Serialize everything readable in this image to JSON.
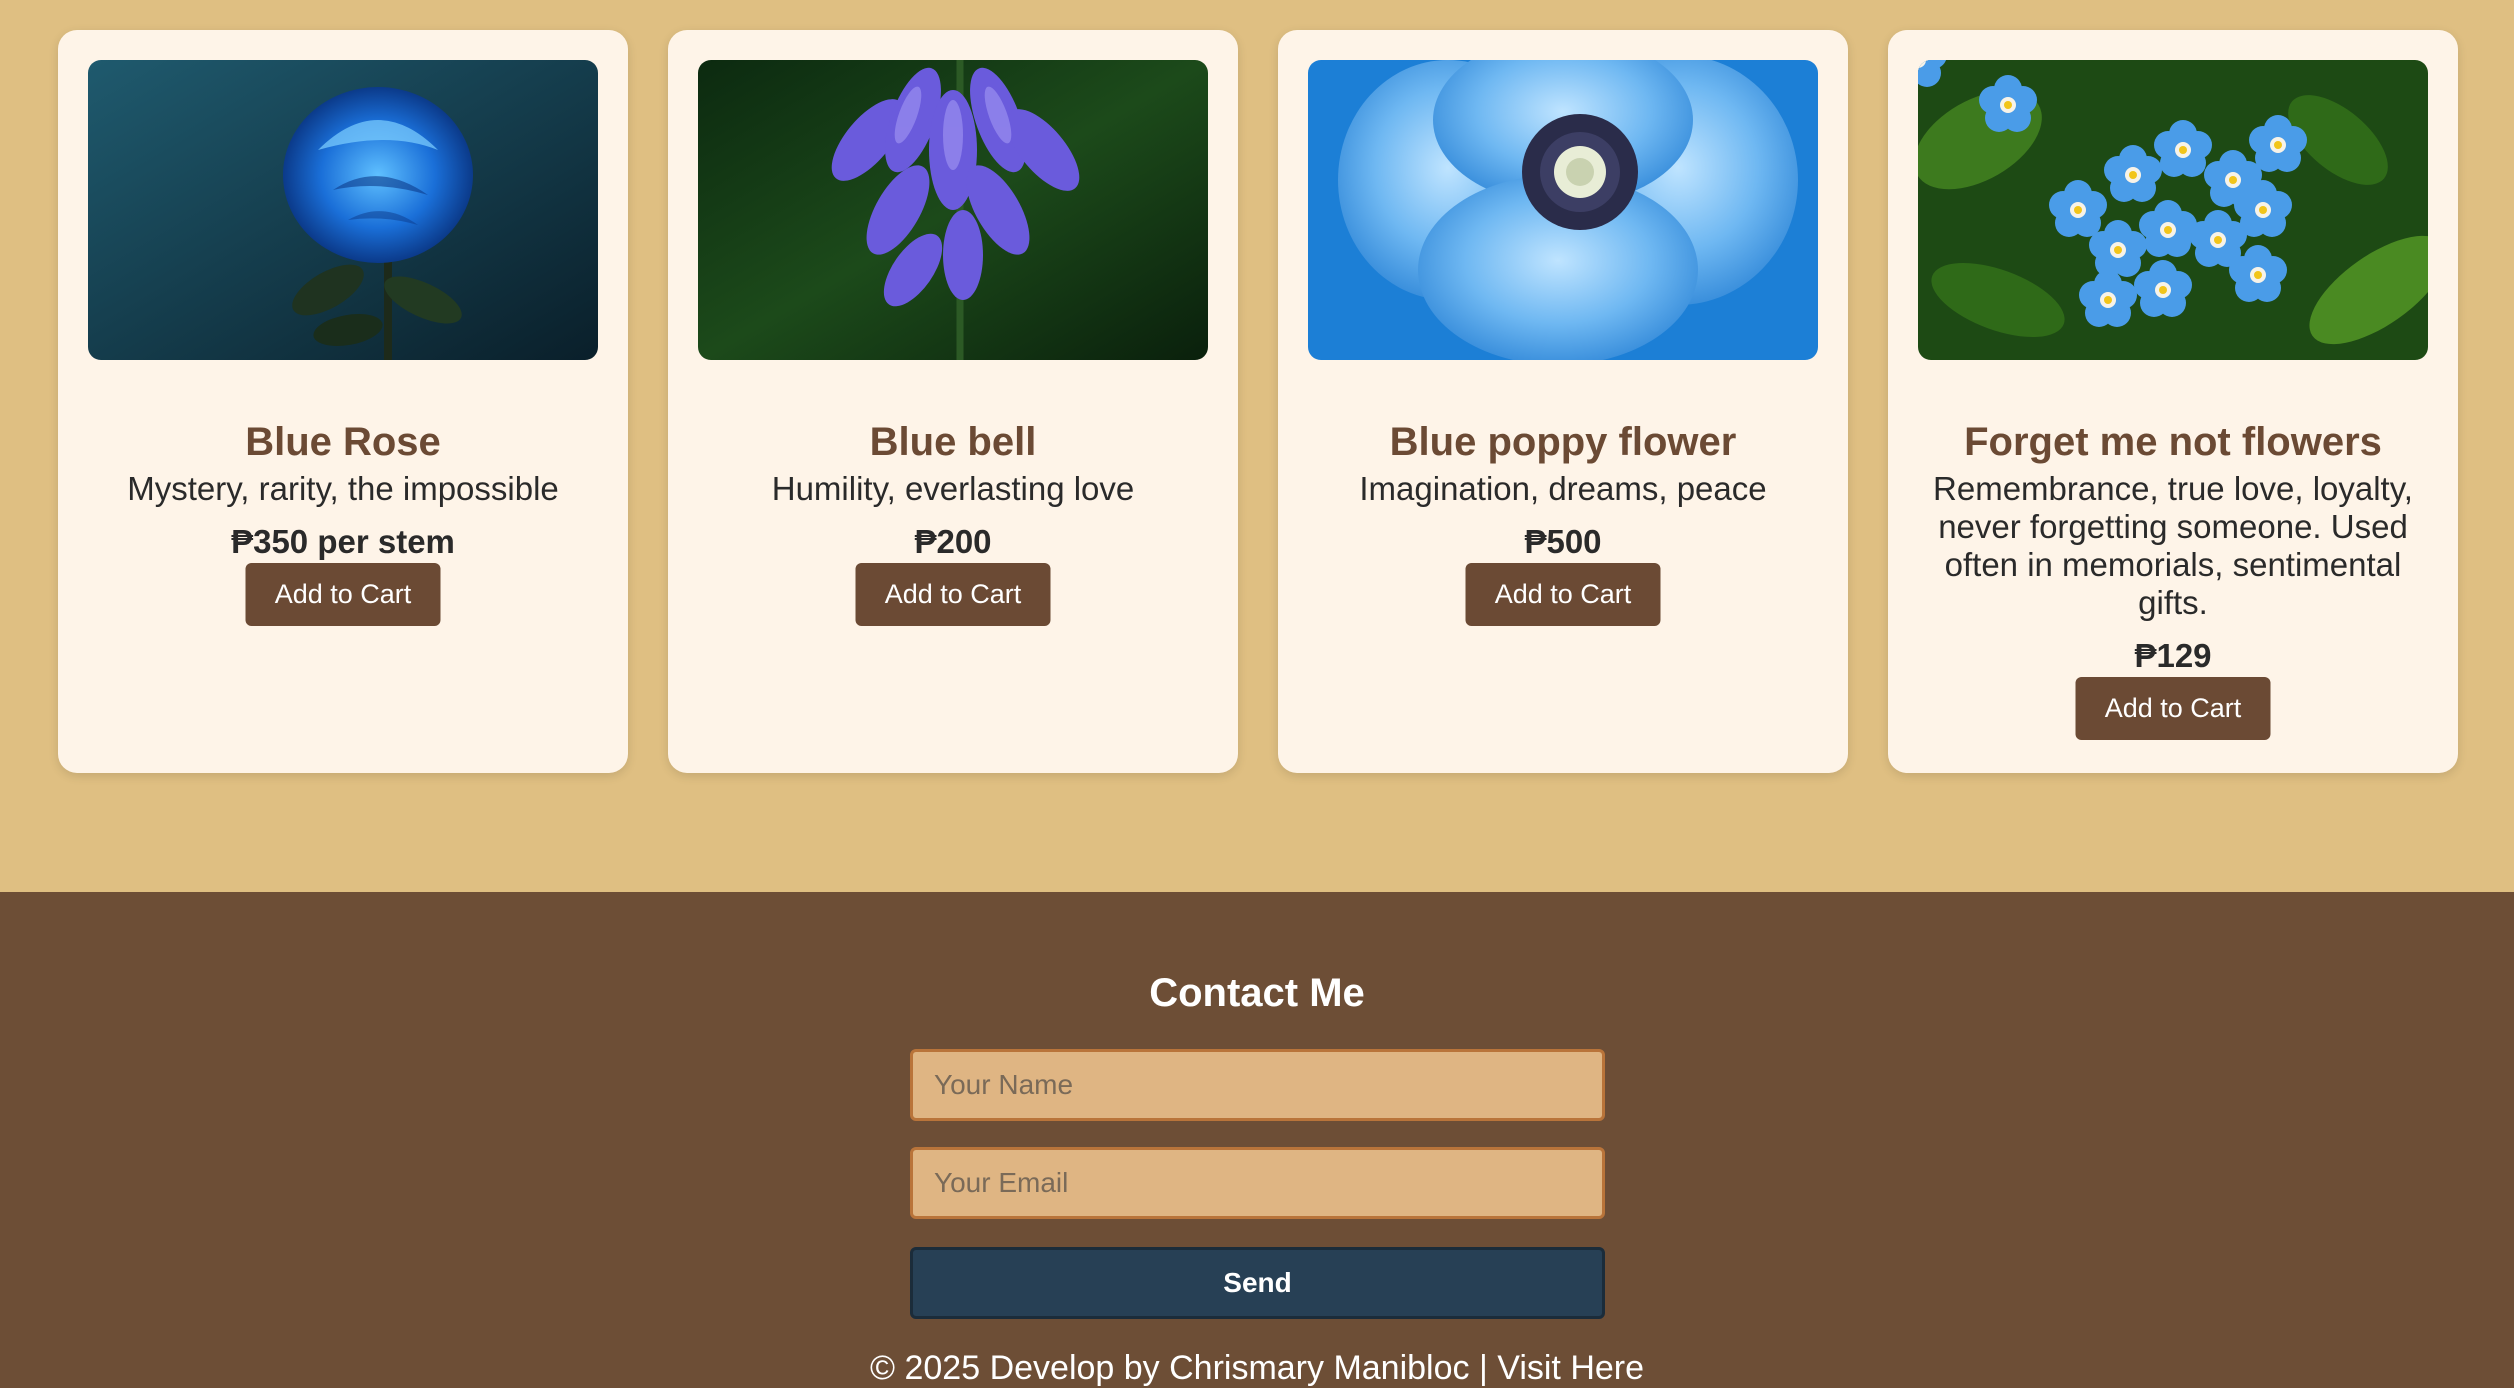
{
  "products": [
    {
      "title": "Blue Rose",
      "description": "Mystery, rarity, the impossible",
      "price": "₱350 per stem",
      "button": "Add to Cart",
      "image": "blue-rose-photo"
    },
    {
      "title": "Blue bell",
      "description": "Humility, everlasting love",
      "price": "₱200",
      "button": "Add to Cart",
      "image": "bluebell-photo"
    },
    {
      "title": "Blue poppy flower",
      "description": "Imagination, dreams, peace",
      "price": "₱500",
      "button": "Add to Cart",
      "image": "blue-poppy-photo"
    },
    {
      "title": "Forget me not flowers",
      "description": "Remembrance, true love, loyalty, never forgetting someone. Used often in memorials, sentimental gifts.",
      "price": "₱129",
      "button": "Add to Cart",
      "image": "forget-me-not-photo"
    }
  ],
  "contact": {
    "title": "Contact Me",
    "name_placeholder": "Your Name",
    "email_placeholder": "Your Email",
    "send_label": "Send"
  },
  "footer": {
    "copyright": "© 2025 Develop by Chrismary Manibloc | ",
    "link_label": "Visit Here"
  },
  "colors": {
    "page_background": "#dfbf82",
    "card_background": "#fef4e8",
    "brand_brown": "#6b4a34",
    "footer_background": "#6d4e36",
    "input_background": "#dfb583",
    "send_button": "#274055"
  }
}
